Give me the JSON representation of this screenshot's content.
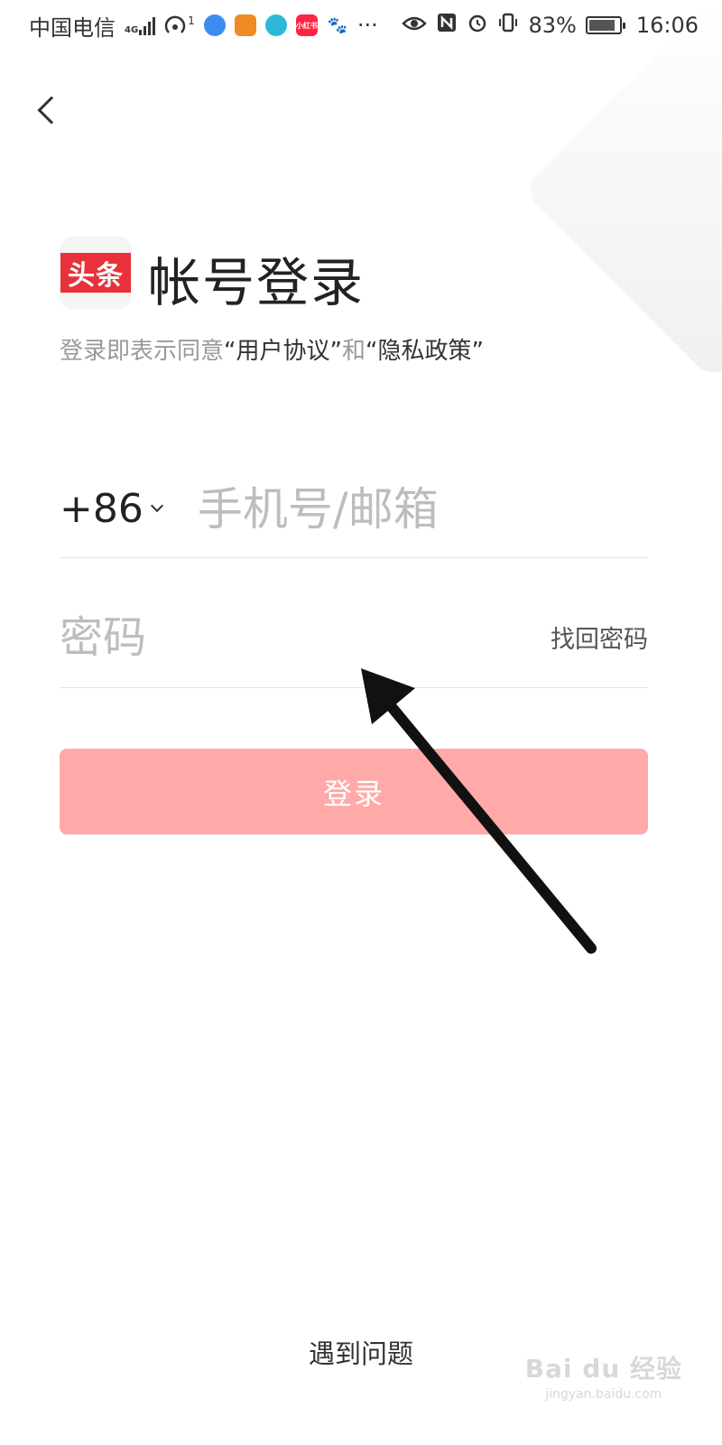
{
  "status_bar": {
    "carrier": "中国电信",
    "network": "4G",
    "hotspot_count": "1",
    "more": "···",
    "battery": "83%",
    "time": "16:06",
    "app_icons": [
      {
        "name": "browser-icon",
        "color": "#3b8ef0",
        "label": ""
      },
      {
        "name": "uc-icon",
        "color": "#f08a24",
        "label": ""
      },
      {
        "name": "chat-icon",
        "color": "#2eb8d8",
        "label": ""
      },
      {
        "name": "xiaohongshu-icon",
        "color": "#ff2442",
        "label": "小红书"
      },
      {
        "name": "baidu-icon",
        "color": "#2f6ee0",
        "label": ""
      }
    ]
  },
  "header": {
    "logo_text": "头条",
    "title": "帐号登录",
    "agreement_prefix": "登录即表示同意",
    "agreement_link1": "“用户协议”",
    "agreement_mid": "和",
    "agreement_link2": "“隐私政策”"
  },
  "form": {
    "country_code": "+86",
    "phone_placeholder": "手机号/邮箱",
    "password_placeholder": "密码",
    "forgot_password": "找回密码",
    "login_label": "登录"
  },
  "footer": {
    "help": "遇到问题"
  },
  "watermark": {
    "main": "Bai du 经验",
    "sub": "jingyan.baidu.com"
  },
  "colors": {
    "brand_red": "#e8313a",
    "login_button": "#ffaaa9",
    "placeholder": "#bdbdbd"
  }
}
